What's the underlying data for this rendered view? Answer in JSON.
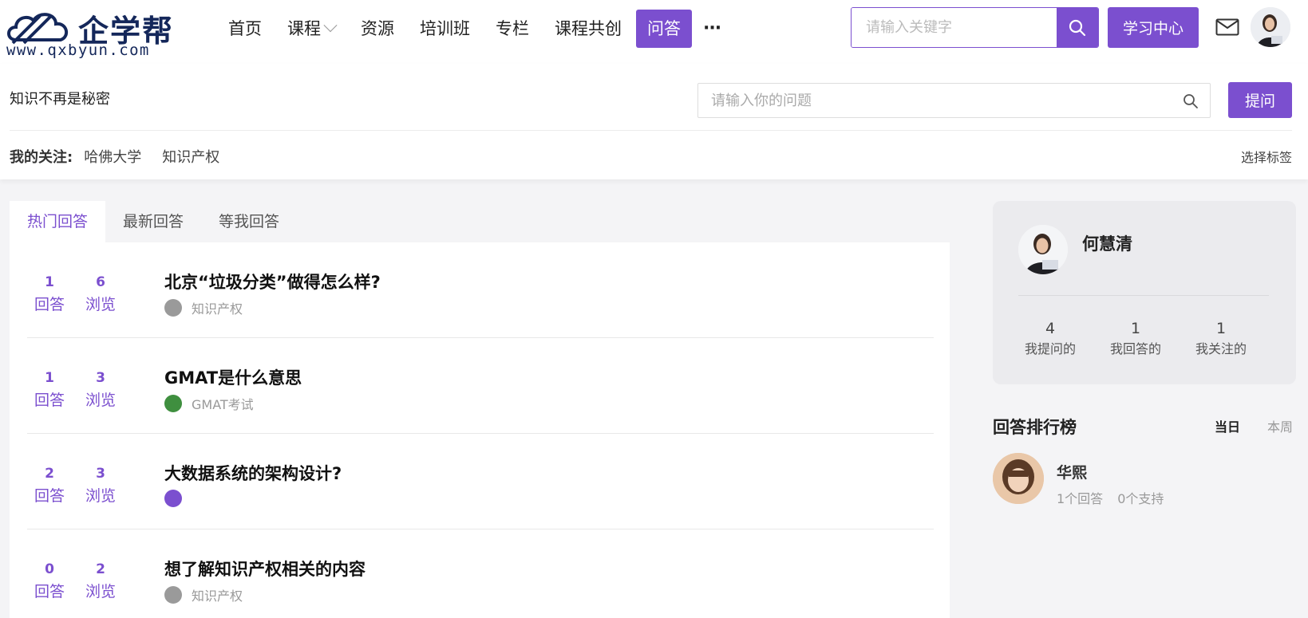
{
  "header": {
    "logo_text": "企学帮",
    "logo_url": "www.qxbyun.com",
    "nav": [
      {
        "label": "首页"
      },
      {
        "label": "课程"
      },
      {
        "label": "资源"
      },
      {
        "label": "培训班"
      },
      {
        "label": "专栏"
      },
      {
        "label": "课程共创"
      },
      {
        "label": "问答"
      },
      {
        "label": "···"
      }
    ],
    "search_placeholder": "请输入关键字",
    "learn_center": "学习中心"
  },
  "subheader": {
    "slogan": "知识不再是秘密",
    "question_placeholder": "请输入你的问题",
    "ask_button": "提问",
    "follow_label": "我的关注:",
    "follow_tags": [
      "哈佛大学",
      "知识产权"
    ],
    "choose_tag": "选择标签"
  },
  "tabs": [
    {
      "label": "热门回答"
    },
    {
      "label": "最新回答"
    },
    {
      "label": "等我回答"
    }
  ],
  "questions": [
    {
      "answers": "1",
      "answers_label": "回答",
      "views": "6",
      "views_label": "浏览",
      "title": "北京“垃圾分类”做得怎么样?",
      "tag": "知识产权",
      "tag_icon_color": "#9a9a9a"
    },
    {
      "answers": "1",
      "answers_label": "回答",
      "views": "3",
      "views_label": "浏览",
      "title": "GMAT是什么意思",
      "tag": "GMAT考试",
      "tag_icon_color": "#3f8f3f"
    },
    {
      "answers": "2",
      "answers_label": "回答",
      "views": "3",
      "views_label": "浏览",
      "title": "大数据系统的架构设计?",
      "tag": "",
      "tag_icon_color": "#7b4fcf"
    },
    {
      "answers": "0",
      "answers_label": "回答",
      "views": "2",
      "views_label": "浏览",
      "title": "想了解知识产权相关的内容",
      "tag": "知识产权",
      "tag_icon_color": "#9a9a9a"
    }
  ],
  "profile": {
    "name": "何慧清",
    "stats": [
      {
        "value": "4",
        "label": "我提问的"
      },
      {
        "value": "1",
        "label": "我回答的"
      },
      {
        "value": "1",
        "label": "我关注的"
      }
    ]
  },
  "ranking": {
    "title": "回答排行榜",
    "today": "当日",
    "week": "本周",
    "top": {
      "name": "华熙",
      "answers": "1个回答",
      "support": "0个支持"
    }
  },
  "colors": {
    "accent": "#7b4fcf",
    "logo": "#14275a"
  }
}
